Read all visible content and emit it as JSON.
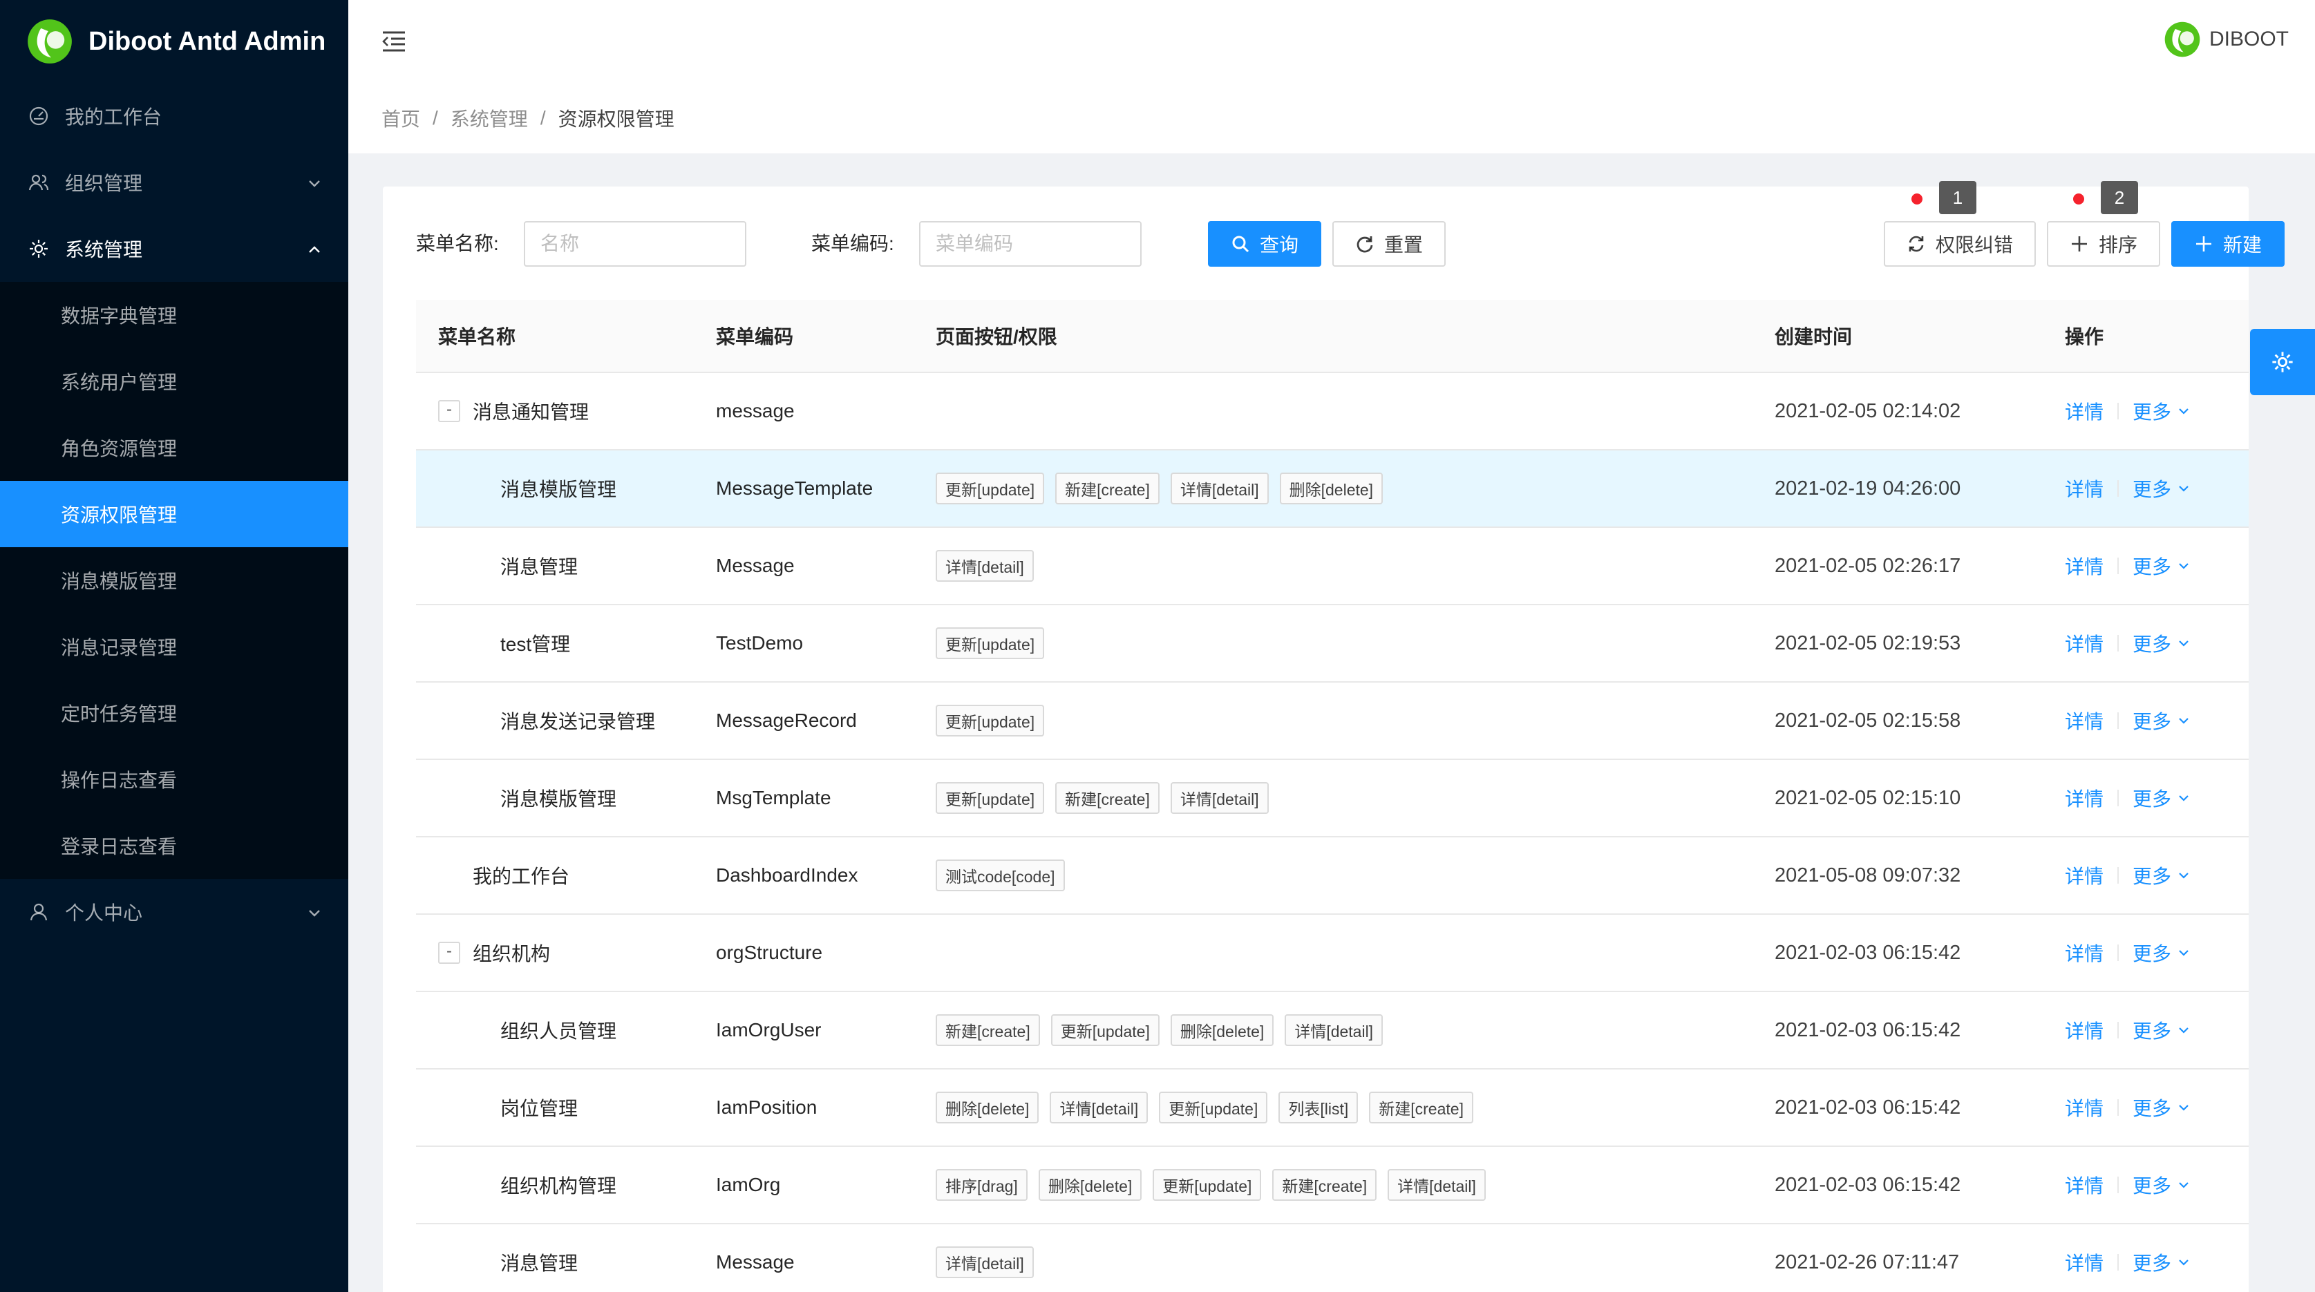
{
  "app": {
    "title": "Diboot Antd Admin"
  },
  "sidebar": {
    "items": [
      {
        "label": "我的工作台",
        "icon": "dashboard-icon"
      },
      {
        "label": "组织管理",
        "icon": "team-icon"
      },
      {
        "label": "系统管理",
        "icon": "setting-icon",
        "open": true,
        "children": [
          {
            "label": "数据字典管理"
          },
          {
            "label": "系统用户管理"
          },
          {
            "label": "角色资源管理"
          },
          {
            "label": "资源权限管理",
            "active": true
          },
          {
            "label": "消息模版管理"
          },
          {
            "label": "消息记录管理"
          },
          {
            "label": "定时任务管理"
          },
          {
            "label": "操作日志查看"
          },
          {
            "label": "登录日志查看"
          }
        ]
      },
      {
        "label": "个人中心",
        "icon": "user-icon"
      }
    ]
  },
  "header": {
    "username": "DIBOOT"
  },
  "breadcrumb": {
    "items": [
      "首页",
      "系统管理",
      "资源权限管理"
    ]
  },
  "filter": {
    "name_label": "菜单名称:",
    "name_placeholder": "名称",
    "code_label": "菜单编码:",
    "code_placeholder": "菜单编码",
    "query_label": "查询",
    "reset_label": "重置",
    "fix_label": "权限纠错",
    "sort_label": "排序",
    "new_label": "新建",
    "tip1": "1",
    "tip2": "2"
  },
  "table": {
    "headers": [
      "菜单名称",
      "菜单编码",
      "页面按钮/权限",
      "创建时间",
      "操作"
    ],
    "detail_label": "详情",
    "more_label": "更多",
    "rows": [
      {
        "name": "消息通知管理",
        "code": "message",
        "perms": [],
        "time": "2021-02-05 02:14:02",
        "level": 0,
        "expander": "-"
      },
      {
        "name": "消息模版管理",
        "code": "MessageTemplate",
        "perms": [
          "更新[update]",
          "新建[create]",
          "详情[detail]",
          "删除[delete]"
        ],
        "time": "2021-02-19 04:26:00",
        "level": 1,
        "highlight": true
      },
      {
        "name": "消息管理",
        "code": "Message",
        "perms": [
          "详情[detail]"
        ],
        "time": "2021-02-05 02:26:17",
        "level": 1
      },
      {
        "name": "test管理",
        "code": "TestDemo",
        "perms": [
          "更新[update]"
        ],
        "time": "2021-02-05 02:19:53",
        "level": 1
      },
      {
        "name": "消息发送记录管理",
        "code": "MessageRecord",
        "perms": [
          "更新[update]"
        ],
        "time": "2021-02-05 02:15:58",
        "level": 1
      },
      {
        "name": "消息模版管理",
        "code": "MsgTemplate",
        "perms": [
          "更新[update]",
          "新建[create]",
          "详情[detail]"
        ],
        "time": "2021-02-05 02:15:10",
        "level": 1
      },
      {
        "name": "我的工作台",
        "code": "DashboardIndex",
        "perms": [
          "测试code[code]"
        ],
        "time": "2021-05-08 09:07:32",
        "level": 0
      },
      {
        "name": "组织机构",
        "code": "orgStructure",
        "perms": [],
        "time": "2021-02-03 06:15:42",
        "level": 0,
        "expander": "-"
      },
      {
        "name": "组织人员管理",
        "code": "IamOrgUser",
        "perms": [
          "新建[create]",
          "更新[update]",
          "删除[delete]",
          "详情[detail]"
        ],
        "time": "2021-02-03 06:15:42",
        "level": 1
      },
      {
        "name": "岗位管理",
        "code": "IamPosition",
        "perms": [
          "删除[delete]",
          "详情[detail]",
          "更新[update]",
          "列表[list]",
          "新建[create]"
        ],
        "time": "2021-02-03 06:15:42",
        "level": 1
      },
      {
        "name": "组织机构管理",
        "code": "IamOrg",
        "perms": [
          "排序[drag]",
          "删除[delete]",
          "更新[update]",
          "新建[create]",
          "详情[detail]"
        ],
        "time": "2021-02-03 06:15:42",
        "level": 1
      },
      {
        "name": "消息管理",
        "code": "Message",
        "perms": [
          "详情[detail]"
        ],
        "time": "2021-02-26 07:11:47",
        "level": 1
      }
    ]
  },
  "colors": {
    "primary": "#1890ff",
    "sidebar_bg": "#001529",
    "submenu_bg": "#000c17",
    "highlight_row": "#e6f7ff"
  }
}
